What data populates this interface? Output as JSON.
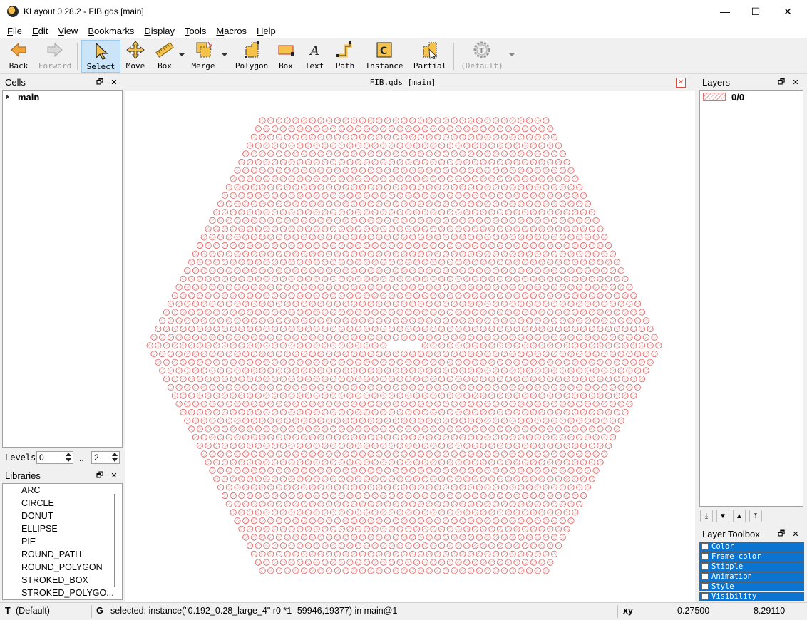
{
  "window": {
    "title": "KLayout 0.28.2 - FIB.gds [main]",
    "minimize": "—",
    "maximize": "☐",
    "close": "✕"
  },
  "menu": [
    {
      "label": "File",
      "u": "F",
      "rest": "ile"
    },
    {
      "label": "Edit",
      "u": "E",
      "rest": "dit"
    },
    {
      "label": "View",
      "u": "V",
      "rest": "iew"
    },
    {
      "label": "Bookmarks",
      "u": "B",
      "rest": "ookmarks"
    },
    {
      "label": "Display",
      "u": "D",
      "rest": "isplay"
    },
    {
      "label": "Tools",
      "u": "T",
      "rest": "ools"
    },
    {
      "label": "Macros",
      "u": "M",
      "rest": "acros"
    },
    {
      "label": "Help",
      "u": "H",
      "rest": "elp"
    }
  ],
  "toolbar": {
    "back": "Back",
    "forward": "Forward",
    "select": "Select",
    "move": "Move",
    "box": "Box",
    "merge": "Merge",
    "polygon": "Polygon",
    "box2": "Box",
    "text": "Text",
    "path": "Path",
    "instance": "Instance",
    "partial": "Partial",
    "default": "(Default)"
  },
  "cells": {
    "title": "Cells",
    "items": [
      "main"
    ],
    "levels_label": "Levels",
    "level_from": "0",
    "level_sep": "..",
    "level_to": "2"
  },
  "libraries": {
    "title": "Libraries",
    "items": [
      "ARC",
      "CIRCLE",
      "DONUT",
      "ELLIPSE",
      "PIE",
      "ROUND_PATH",
      "ROUND_POLYGON",
      "STROKED_BOX",
      "STROKED_POLYGO..."
    ]
  },
  "canvas": {
    "tab_title": "FIB.gds [main]",
    "close": "✕",
    "shape_color": "#e06464",
    "hole_pattern": "hexagonal array of circular holes with a missing center row segment"
  },
  "layers": {
    "title": "Layers",
    "items": [
      {
        "name": "0/0",
        "color": "#e07070"
      }
    ]
  },
  "layer_toolbox": {
    "title": "Layer Toolbox",
    "rows": [
      "Color",
      "Frame color",
      "Stipple",
      "Animation",
      "Style",
      "Visibility"
    ]
  },
  "status": {
    "mode_icon": "T",
    "mode": "(Default)",
    "grid_icon": "G",
    "message": "selected: instance(\"0.192_0.28_large_4\" r0 *1 -59946,19377) in main@1",
    "coord_label": "xy",
    "x": "0.27500",
    "y": "8.29110"
  },
  "colors": {
    "accent": "#0a74d0",
    "select_bg": "#cce4f7",
    "shape": "#e06464"
  }
}
